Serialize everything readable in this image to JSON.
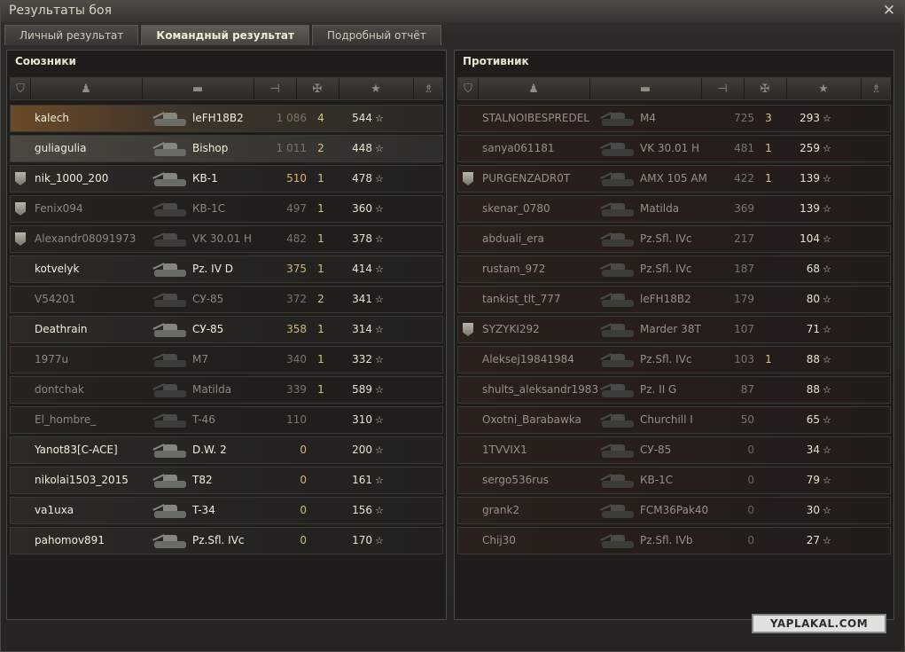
{
  "window": {
    "title": "Результаты боя"
  },
  "tabs": [
    {
      "label": "Личный результат"
    },
    {
      "label": "Командный результат"
    },
    {
      "label": "Подробный отчёт"
    }
  ],
  "allies": {
    "title": "Союзники",
    "rows": [
      {
        "name": "kalech",
        "tank": "leFH18B2",
        "damage": "1 086",
        "kills": "4",
        "xp": "544",
        "state": "me",
        "badge": false,
        "dmg_style": "dim"
      },
      {
        "name": "guliagulia",
        "tank": "Bishop",
        "damage": "1 011",
        "kills": "2",
        "xp": "448",
        "state": "platoon",
        "badge": false,
        "dmg_style": "dim"
      },
      {
        "name": "nik_1000_200",
        "tank": "КВ-1",
        "damage": "510",
        "kills": "1",
        "xp": "478",
        "state": "alive",
        "badge": true,
        "dmg_style": "gold"
      },
      {
        "name": "Fenix094",
        "tank": "КВ-1С",
        "damage": "497",
        "kills": "1",
        "xp": "360",
        "state": "dead",
        "badge": true,
        "dmg_style": "dim"
      },
      {
        "name": "Alexandr08091973",
        "tank": "VK 30.01 H",
        "damage": "482",
        "kills": "1",
        "xp": "378",
        "state": "dead",
        "badge": true,
        "dmg_style": "dim"
      },
      {
        "name": "kotvelyk",
        "tank": "Pz. IV D",
        "damage": "375",
        "kills": "1",
        "xp": "414",
        "state": "alive",
        "badge": false,
        "dmg_style": "gold"
      },
      {
        "name": "V54201",
        "tank": "СУ-85",
        "damage": "372",
        "kills": "2",
        "xp": "341",
        "state": "dead",
        "badge": false,
        "dmg_style": "dim"
      },
      {
        "name": "Deathrain",
        "tank": "СУ-85",
        "damage": "358",
        "kills": "1",
        "xp": "314",
        "state": "alive",
        "badge": false,
        "dmg_style": "gold"
      },
      {
        "name": "1977u",
        "tank": "M7",
        "damage": "340",
        "kills": "1",
        "xp": "332",
        "state": "dead",
        "badge": false,
        "dmg_style": "dim"
      },
      {
        "name": "dontchak",
        "tank": "Matilda",
        "damage": "339",
        "kills": "1",
        "xp": "589",
        "state": "dead",
        "badge": false,
        "dmg_style": "dim"
      },
      {
        "name": "El_hombre_",
        "tank": "T-46",
        "damage": "110",
        "kills": "",
        "xp": "310",
        "state": "dead",
        "badge": false,
        "dmg_style": "dim"
      },
      {
        "name": "Yanot83[C-ACE]",
        "tank": "D.W. 2",
        "damage": "0",
        "kills": "",
        "xp": "200",
        "state": "alive",
        "badge": false,
        "dmg_style": "zero-a"
      },
      {
        "name": "nikolai1503_2015",
        "tank": "T82",
        "damage": "0",
        "kills": "",
        "xp": "161",
        "state": "alive",
        "badge": false,
        "dmg_style": "zero-a"
      },
      {
        "name": "va1uxa",
        "tank": "T-34",
        "damage": "0",
        "kills": "",
        "xp": "156",
        "state": "alive",
        "badge": false,
        "dmg_style": "zero-a"
      },
      {
        "name": "pahomov891",
        "tank": "Pz.Sfl. IVc",
        "damage": "0",
        "kills": "",
        "xp": "170",
        "state": "alive",
        "badge": false,
        "dmg_style": "zero-a"
      }
    ]
  },
  "enemies": {
    "title": "Противник",
    "rows": [
      {
        "name": "STALNOIBESPREDEL",
        "tank": "M4",
        "damage": "725",
        "kills": "3",
        "xp": "293",
        "state": "enemy-dead",
        "badge": false
      },
      {
        "name": "sanya061181",
        "tank": "VK 30.01 H",
        "damage": "481",
        "kills": "1",
        "xp": "259",
        "state": "enemy-dead",
        "badge": false
      },
      {
        "name": "PURGENZADR0T",
        "tank": "AMX 105 AM",
        "damage": "422",
        "kills": "1",
        "xp": "139",
        "state": "enemy-dead",
        "badge": true
      },
      {
        "name": "skenar_0780",
        "tank": "Matilda",
        "damage": "369",
        "kills": "",
        "xp": "139",
        "state": "enemy-dead",
        "badge": false
      },
      {
        "name": "abduali_era",
        "tank": "Pz.Sfl. IVc",
        "damage": "217",
        "kills": "",
        "xp": "104",
        "state": "enemy-dead",
        "badge": false
      },
      {
        "name": "rustam_972",
        "tank": "Pz.Sfl. IVc",
        "damage": "187",
        "kills": "",
        "xp": "68",
        "state": "enemy-dead",
        "badge": false
      },
      {
        "name": "tankist_tlt_777",
        "tank": "leFH18B2",
        "damage": "179",
        "kills": "",
        "xp": "80",
        "state": "enemy-dead",
        "badge": false
      },
      {
        "name": "SYZYKI292",
        "tank": "Marder 38T",
        "damage": "107",
        "kills": "",
        "xp": "71",
        "state": "enemy-dead",
        "badge": true
      },
      {
        "name": "Aleksej19841984",
        "tank": "Pz.Sfl. IVc",
        "damage": "103",
        "kills": "1",
        "xp": "88",
        "state": "enemy-dead",
        "badge": false
      },
      {
        "name": "shults_aleksandr1983",
        "tank": "Pz. II G",
        "damage": "87",
        "kills": "",
        "xp": "88",
        "state": "enemy-dead",
        "badge": false
      },
      {
        "name": "Oxotni_Barabawka",
        "tank": "Churchill I",
        "damage": "50",
        "kills": "",
        "xp": "65",
        "state": "enemy-dead",
        "badge": false
      },
      {
        "name": "1TVVIX1",
        "tank": "СУ-85",
        "damage": "0",
        "kills": "",
        "xp": "34",
        "state": "enemy-dead",
        "badge": false
      },
      {
        "name": "sergo536rus",
        "tank": "КВ-1С",
        "damage": "0",
        "kills": "",
        "xp": "79",
        "state": "enemy-dead",
        "badge": false
      },
      {
        "name": "grank2",
        "tank": "FCM36Pak40",
        "damage": "0",
        "kills": "",
        "xp": "30",
        "state": "enemy-dead",
        "badge": false
      },
      {
        "name": "Chij30",
        "tank": "Pz.Sfl. IVb",
        "damage": "0",
        "kills": "",
        "xp": "27",
        "state": "enemy-dead",
        "badge": false
      }
    ]
  },
  "columns": [
    {
      "icon": "clan-badge-icon"
    },
    {
      "icon": "player-icon"
    },
    {
      "icon": "tank-icon"
    },
    {
      "icon": "damage-icon"
    },
    {
      "icon": "kills-icon"
    },
    {
      "icon": "star-icon"
    },
    {
      "icon": "medal-icon"
    }
  ],
  "star_glyph": "☆",
  "close_glyph": "✕",
  "watermark": "YAPLAKAL.COM"
}
